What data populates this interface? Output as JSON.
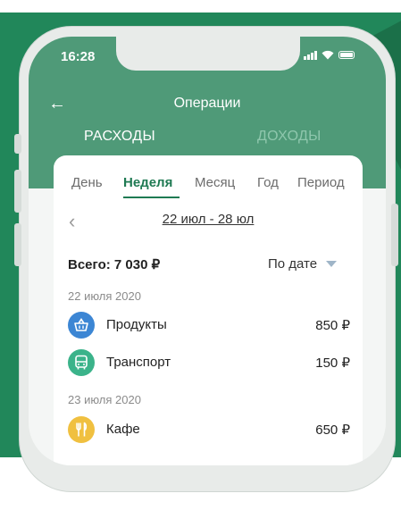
{
  "status_bar": {
    "time": "16:28"
  },
  "header": {
    "title": "Операции",
    "tabs": {
      "expenses": "РАСХОДЫ",
      "income": "ДОХОДЫ"
    }
  },
  "period_tabs": [
    "День",
    "Неделя",
    "Месяц",
    "Год",
    "Период"
  ],
  "active_period": "Неделя",
  "date_range": "22 июл - 28 юл",
  "summary": {
    "total": "Всего: 7 030 ₽",
    "sort_label": "По дате"
  },
  "days": [
    {
      "date": "22 июля 2020",
      "items": [
        {
          "label": "Продукты",
          "amount": "850 ₽",
          "icon": "basket-icon",
          "color": "#3c86d4"
        },
        {
          "label": "Транспорт",
          "amount": "150 ₽",
          "icon": "bus-icon",
          "color": "#3bb38a"
        }
      ]
    },
    {
      "date": "23 июля 2020",
      "items": [
        {
          "label": "Кафе",
          "amount": "650 ₽",
          "icon": "fork-knife-icon",
          "color": "#f0c040"
        }
      ]
    }
  ],
  "colors": {
    "accent": "#1f7a53",
    "header": "#4f9a78",
    "background": "#21875a"
  }
}
